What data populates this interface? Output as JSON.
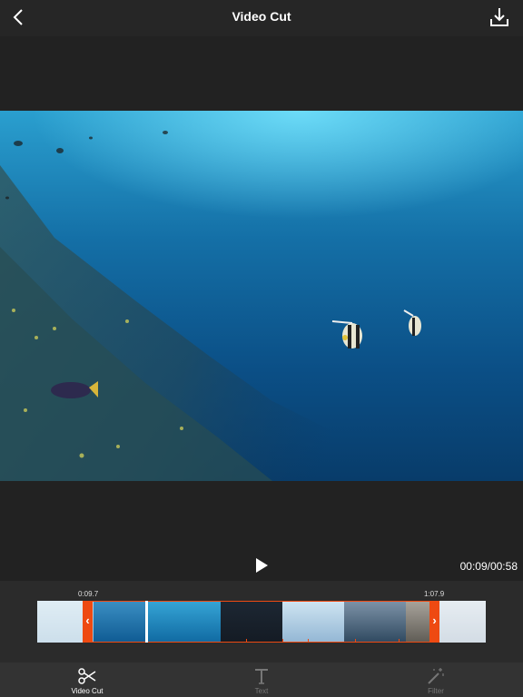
{
  "header": {
    "title": "Video Cut",
    "back_icon": "chevron-left-icon",
    "download_icon": "download-icon"
  },
  "player": {
    "timecode": "00:09/00:58",
    "play_icon": "play-icon"
  },
  "timeline": {
    "start_label": "0:09.7",
    "end_label": "1:07.9",
    "accent": "#ee4a12"
  },
  "tabs": [
    {
      "label": "Video Cut",
      "icon": "scissors-icon",
      "active": true
    },
    {
      "label": "Text",
      "icon": "text-icon",
      "active": false
    },
    {
      "label": "Filter",
      "icon": "magic-wand-icon",
      "active": false
    }
  ]
}
